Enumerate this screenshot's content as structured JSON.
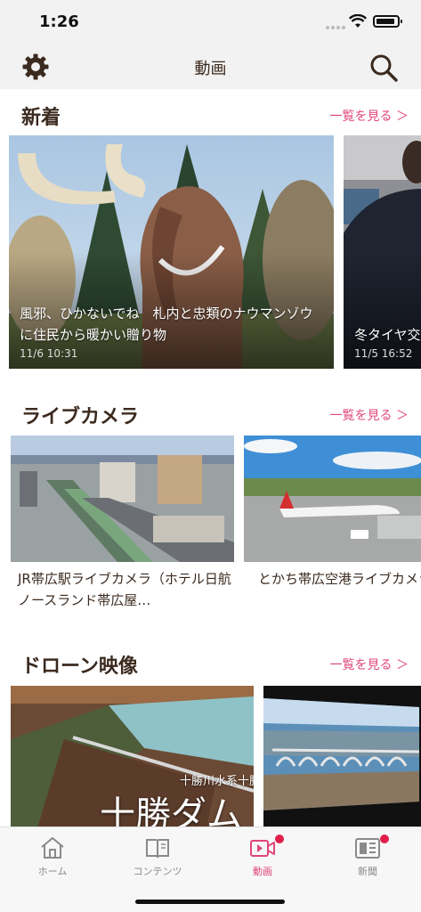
{
  "status_bar": {
    "time": "1:26"
  },
  "nav": {
    "title": "動画",
    "settings_icon": "gear-icon",
    "search_icon": "search-icon"
  },
  "sections": {
    "new": {
      "title": "新着",
      "more": "一覧を見る ＞",
      "cards": [
        {
          "title": "風邪、ひかないでね　札内と忠類のナウマンゾウに住民から暖かい贈り物",
          "date": "11/6 10:31"
        },
        {
          "title": "冬タイヤ交換",
          "date": "11/5 16:52"
        }
      ]
    },
    "live": {
      "title": "ライブカメラ",
      "more": "一覧を見る ＞",
      "cards": [
        {
          "title": "JR帯広駅ライブカメラ（ホテル日航ノースランド帯広屋…"
        },
        {
          "title": "とかち帯広空港ライブカメラ"
        }
      ]
    },
    "drone": {
      "title": "ドローン映像",
      "more": "一覧を見る ＞",
      "cards": [
        {
          "overlay_small": "十勝川水系十勝",
          "overlay_big": "十勝ダム"
        },
        {
          "overlay_small": ""
        }
      ]
    }
  },
  "tabs": [
    {
      "label": "ホーム",
      "icon": "home-icon",
      "active": false,
      "badge": false
    },
    {
      "label": "コンテンツ",
      "icon": "book-icon",
      "active": false,
      "badge": false
    },
    {
      "label": "動画",
      "icon": "video-icon",
      "active": true,
      "badge": true
    },
    {
      "label": "新聞",
      "icon": "newspaper-icon",
      "active": false,
      "badge": true
    }
  ],
  "colors": {
    "accent": "#e0457b",
    "text": "#3b2a1f",
    "badge": "#e0204a"
  }
}
